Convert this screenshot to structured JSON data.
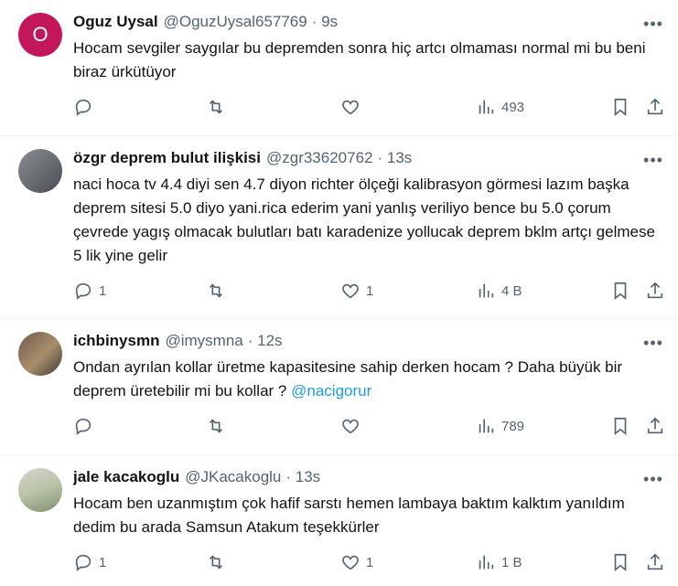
{
  "tweets": [
    {
      "name": "Oguz Uysal",
      "handle": "@OguzUysal657769",
      "time": "· 9s",
      "avatar_letter": "O",
      "text": "Hocam sevgiler saygılar bu depremden sonra hiç artcı olmaması normal mi bu beni biraz ürkütüyor",
      "replies": "",
      "likes": "",
      "views": "493"
    },
    {
      "name": "özgr deprem bulut ilişkisi",
      "handle": "@zgr33620762",
      "time": "· 13s",
      "text": "naci hoca tv 4.4 diyi sen 4.7 diyon richter ölçeği kalibrasyon görmesi lazım başka deprem sitesi 5.0 diyo yani.rica ederim yani yanlış veriliyo bence bu 5.0 çorum çevrede yagış olmacak bulutları batı karadenize yollucak deprem bklm artçı gelmese 5 lik yine gelir",
      "replies": "1",
      "likes": "1",
      "views": "4 B"
    },
    {
      "name": "ichbinysmn",
      "handle": "@imysmna",
      "time": "· 12s",
      "text": "Ondan ayrılan kollar üretme kapasitesine sahip derken hocam ? Daha büyük bir deprem üretebilir mi bu kollar ?",
      "mention": "@nacigorur",
      "replies": "",
      "likes": "",
      "views": "789"
    },
    {
      "name": "jale kacakoglu",
      "handle": "@JKacakoglu",
      "time": "· 13s",
      "text": "Hocam ben uzanmıştım çok hafif sarstı hemen lambaya baktım kalktım yanıldım dedim bu arada Samsun Atakum teşekkürler",
      "replies": "1",
      "likes": "1",
      "views": "1 B"
    }
  ],
  "more_glyph": "•••",
  "icons": [
    "reply-icon",
    "retweet-icon",
    "like-icon",
    "views-icon",
    "bookmark-icon",
    "share-icon",
    "more-icon"
  ]
}
